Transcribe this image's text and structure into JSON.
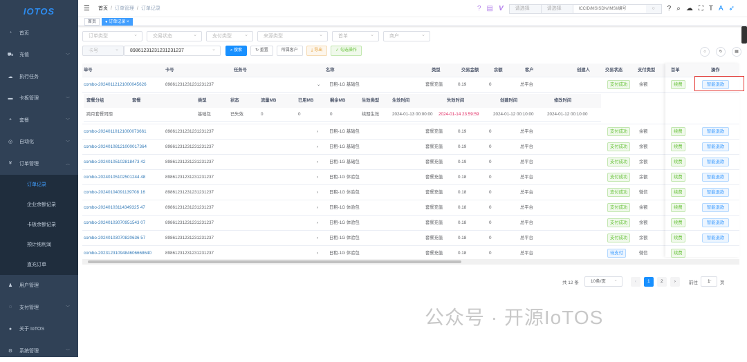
{
  "logo": "IOTOS",
  "sidebar": {
    "items": [
      {
        "icon": "dashboard",
        "label": "首页"
      },
      {
        "icon": "cart",
        "label": "充值"
      },
      {
        "icon": "cloud",
        "label": "执行任务"
      },
      {
        "icon": "card",
        "label": "卡板管理"
      },
      {
        "icon": "package",
        "label": "套餐"
      },
      {
        "icon": "robot",
        "label": "自动化"
      },
      {
        "icon": "yen",
        "label": "订单管理"
      }
    ],
    "sub_items": [
      "订单记录",
      "企业余额记录",
      "卡板余额记录",
      "预计纯利润",
      "直充订单"
    ],
    "items_after": [
      {
        "icon": "user",
        "label": "用户管理"
      },
      {
        "icon": "pay",
        "label": "支付管理"
      },
      {
        "icon": "globe",
        "label": "关于 IoTOS"
      },
      {
        "icon": "gear",
        "label": "系统管理"
      }
    ]
  },
  "breadcrumb": [
    "首页",
    "订单管理",
    "订单记录"
  ],
  "tags": [
    "首页",
    "订单记录"
  ],
  "topbar": {
    "select1": "请选择",
    "select2": "请选择",
    "search_placeholder": "ICCID/MSISDN/IMSI/编号"
  },
  "filters": [
    "订单类型",
    "交易状态",
    "支付类型",
    "来源类型",
    "首单",
    "商户"
  ],
  "search": {
    "field": "卡号",
    "value": "89861231231231231237",
    "search": "搜索",
    "reset": "重置",
    "customer": "所属客户",
    "export": "导出",
    "batch": "勾选操作"
  },
  "columns": [
    "单号",
    "卡号",
    "任务号",
    "名称",
    "类型",
    "交易金额",
    "余额",
    "客户",
    "创建人",
    "交易状态",
    "支付类型",
    "首单",
    "操作"
  ],
  "expanded_columns": [
    "套餐分组",
    "套餐",
    "类型",
    "状态",
    "流量MB",
    "已用MB",
    "剩余MB",
    "生效类型",
    "生效时间",
    "失效时间",
    "创建时间",
    "修改时间"
  ],
  "expanded_row": [
    "跨月套餐同期",
    "",
    "基础包",
    "已失效",
    "0",
    "0",
    "0",
    "续期生效",
    "2024-01-13 00:00:00",
    "2024-01-14 23:59:59",
    "2024-01-12 00:10:00",
    "2024-01-12 00:10:00"
  ],
  "rows": [
    {
      "id": "combo-20240112121000045626",
      "card": "89861231231231231237",
      "name": "日租-1G 基础包",
      "type": "套餐充值",
      "amount": "0.19",
      "balance": "0",
      "customer": "总平台",
      "status": "支付成功",
      "pay": "余额",
      "first": "续费",
      "action": "智能退款"
    },
    {
      "id": "combo-20240110121000073661",
      "card": "89861231231231231237",
      "name": "日租-1G 基础包",
      "type": "套餐充值",
      "amount": "0.19",
      "balance": "0",
      "customer": "总平台",
      "status": "支付成功",
      "pay": "余额",
      "first": "续费",
      "action": "智能退款"
    },
    {
      "id": "combo-20240108121000017364",
      "card": "89861231231231231237",
      "name": "日租-1G 基础包",
      "type": "套餐充值",
      "amount": "0.19",
      "balance": "0",
      "customer": "总平台",
      "status": "支付成功",
      "pay": "余额",
      "first": "续费",
      "action": "智能退款"
    },
    {
      "id": "combo-20240105102818473 42",
      "card": "89861231231231231237",
      "name": "日租-1G 基础包",
      "type": "套餐充值",
      "amount": "0.19",
      "balance": "0",
      "customer": "总平台",
      "status": "支付成功",
      "pay": "余额",
      "first": "续费",
      "action": "智能退款"
    },
    {
      "id": "combo-20240105102501244 48",
      "card": "89861231231231231237",
      "name": "日租-1G 体验包",
      "type": "套餐充值",
      "amount": "0.18",
      "balance": "0",
      "customer": "总平台",
      "status": "支付成功",
      "pay": "余额",
      "first": "续费",
      "action": "智能退款"
    },
    {
      "id": "combo-20240104091139708 16",
      "card": "89861231231231231237",
      "name": "日租-1G 体验包",
      "type": "套餐充值",
      "amount": "0.18",
      "balance": "0",
      "customer": "总平台",
      "status": "支付成功",
      "pay": "微信",
      "first": "续费",
      "action": "智能退款"
    },
    {
      "id": "combo-20240103114349325 47",
      "card": "89861231231231231237",
      "name": "日租-1G 体验包",
      "type": "套餐充值",
      "amount": "0.18",
      "balance": "0",
      "customer": "总平台",
      "status": "支付成功",
      "pay": "余额",
      "first": "续费",
      "action": "智能退款"
    },
    {
      "id": "combo-20240103070951543 07",
      "card": "89861231231231231237",
      "name": "日租-1G 体验包",
      "type": "套餐充值",
      "amount": "0.18",
      "balance": "0",
      "customer": "总平台",
      "status": "支付成功",
      "pay": "余额",
      "first": "续费",
      "action": "智能退款"
    },
    {
      "id": "combo-20240103070820636 57",
      "card": "89861231231231231237",
      "name": "日租-1G 体验包",
      "type": "套餐充值",
      "amount": "0.18",
      "balance": "0",
      "customer": "总平台",
      "status": "支付成功",
      "pay": "余额",
      "first": "续费",
      "action": "智能退款"
    },
    {
      "id": "combo-2023123109484606668640",
      "card": "89861231231231231237",
      "name": "日租-1G 体验包",
      "type": "套餐充值",
      "amount": "0.18",
      "balance": "0",
      "customer": "总平台",
      "status": "待支付",
      "pay": "微信",
      "first": "续费",
      "action": ""
    }
  ],
  "pagination": {
    "total": "共 12 条",
    "page_size": "10条/页",
    "pages": [
      "1",
      "2"
    ],
    "goto": "前往",
    "goto_value": "1",
    "page_unit": "页"
  },
  "watermark": "公众号 · 开源IoTOS"
}
